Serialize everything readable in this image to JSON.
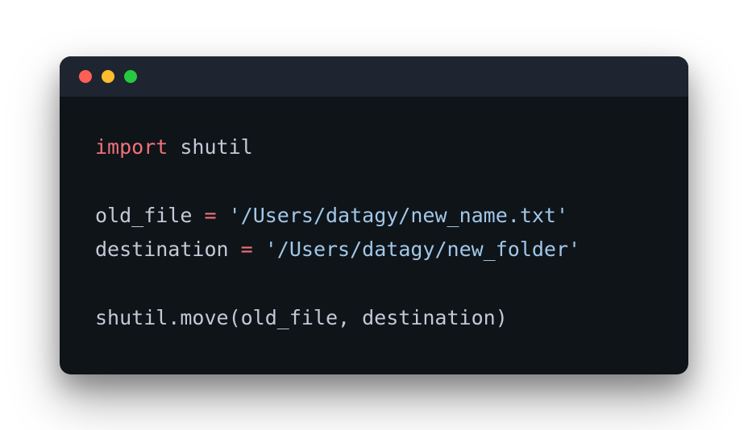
{
  "titlebar": {
    "buttons": {
      "close_color": "#ff5f56",
      "minimize_color": "#ffbd2e",
      "maximize_color": "#27c93f"
    }
  },
  "code": {
    "line1": {
      "keyword": "import",
      "space1": " ",
      "module": "shutil"
    },
    "line3": {
      "var": "old_file ",
      "op": "=",
      "space": " ",
      "string": "'/Users/datagy/new_name.txt'"
    },
    "line4": {
      "var": "destination ",
      "op": "=",
      "space": " ",
      "string": "'/Users/datagy/new_folder'"
    },
    "line6": {
      "call": "shutil.move(old_file, destination)"
    }
  }
}
